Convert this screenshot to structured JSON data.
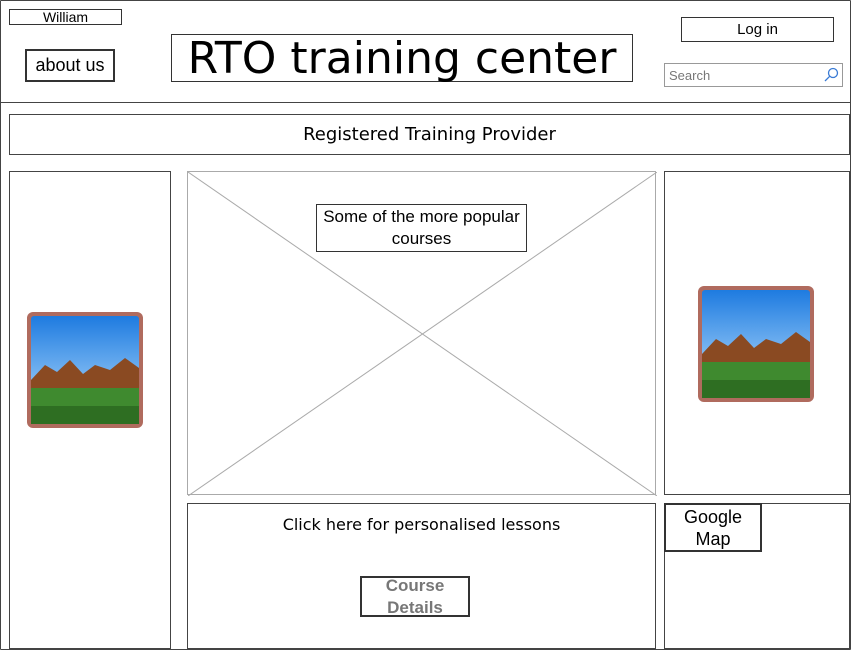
{
  "header": {
    "user_name": "William",
    "about_label": "about us",
    "title": "RTO training center",
    "login_label": "Log in",
    "search_placeholder": "Search"
  },
  "banner": {
    "text": "Registered Training Provider"
  },
  "main": {
    "courses_label": "Some of the more popular courses",
    "lessons_text": "Click here for personalised lessons",
    "course_details_label": "Course Details",
    "map_label": "Google Map"
  },
  "icons": {
    "search": "search-icon",
    "image_left": "landscape-image-icon",
    "image_right": "landscape-image-icon"
  }
}
